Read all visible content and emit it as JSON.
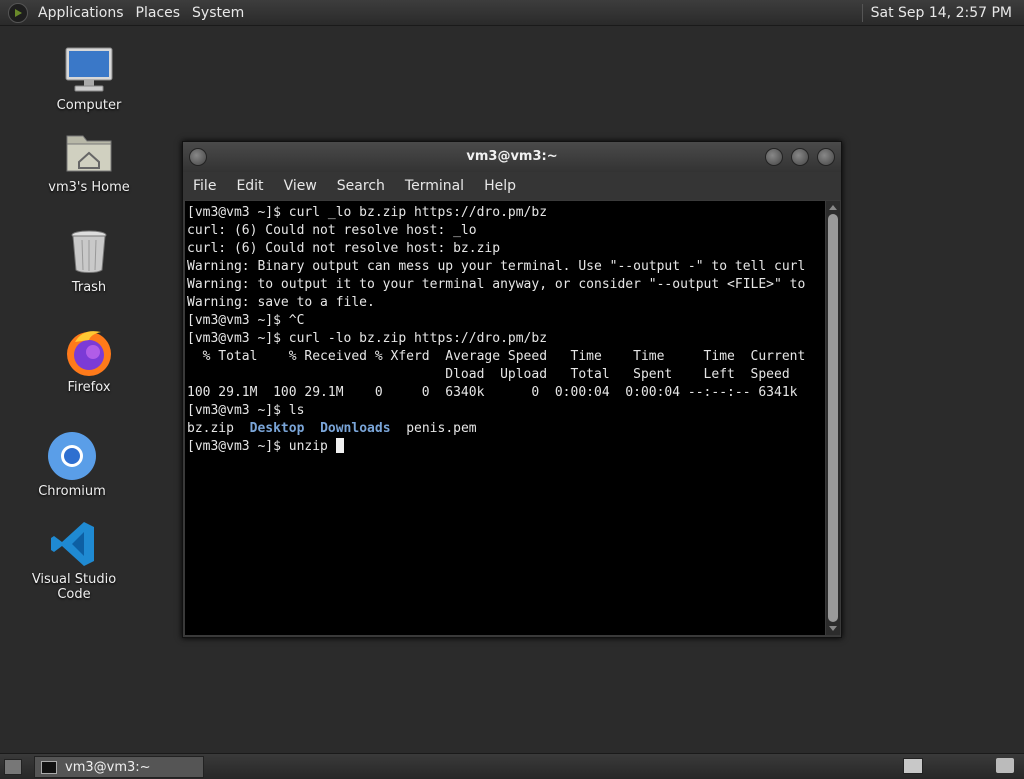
{
  "top_panel": {
    "menus": [
      "Applications",
      "Places",
      "System"
    ],
    "clock": "Sat Sep 14,  2:57 PM"
  },
  "desktop_icons": [
    {
      "label": "Computer",
      "icon": "computer-icon"
    },
    {
      "label": "vm3's Home",
      "icon": "home-folder-icon"
    },
    {
      "label": "Trash",
      "icon": "trash-icon"
    },
    {
      "label": "Firefox",
      "icon": "firefox-icon"
    },
    {
      "label": "Chromium",
      "icon": "chromium-icon"
    },
    {
      "label": "Visual Studio Code",
      "icon": "vscode-icon"
    }
  ],
  "terminal": {
    "title": "vm3@vm3:~",
    "menus": [
      "File",
      "Edit",
      "View",
      "Search",
      "Terminal",
      "Help"
    ],
    "lines": [
      "[vm3@vm3 ~]$ curl _lo bz.zip https://dro.pm/bz",
      "curl: (6) Could not resolve host: _lo",
      "curl: (6) Could not resolve host: bz.zip",
      "Warning: Binary output can mess up your terminal. Use \"--output -\" to tell curl",
      "Warning: to output it to your terminal anyway, or consider \"--output <FILE>\" to",
      "Warning: save to a file.",
      "[vm3@vm3 ~]$ ^C",
      "[vm3@vm3 ~]$ curl -lo bz.zip https://dro.pm/bz",
      "  % Total    % Received % Xferd  Average Speed   Time    Time     Time  Current",
      "                                 Dload  Upload   Total   Spent    Left  Speed",
      "100 29.1M  100 29.1M    0     0  6340k      0  0:00:04  0:00:04 --:--:-- 6341k",
      "[vm3@vm3 ~]$ ls"
    ],
    "ls_output": {
      "file1": "bz.zip",
      "dir1": "Desktop",
      "dir2": "Downloads",
      "file2": "penis.pem"
    },
    "current_prompt": "[vm3@vm3 ~]$ unzip "
  },
  "bottom_panel": {
    "task_label": "vm3@vm3:~"
  }
}
